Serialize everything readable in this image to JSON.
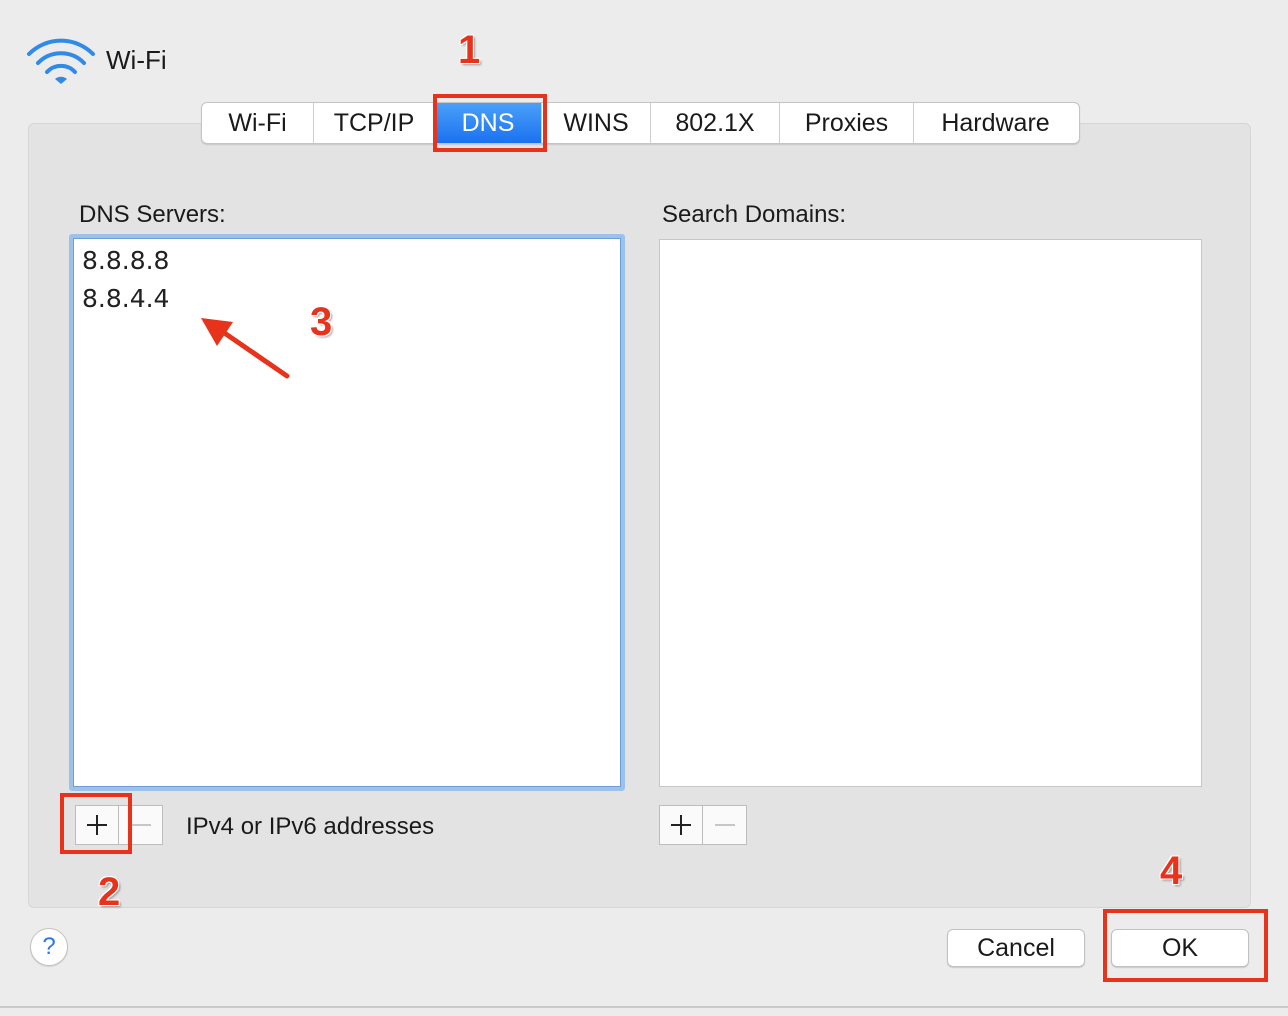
{
  "header": {
    "title": "Wi-Fi",
    "icon": "wifi-icon"
  },
  "tabs": [
    {
      "label": "Wi-Fi"
    },
    {
      "label": "TCP/IP"
    },
    {
      "label": "DNS",
      "selected": true
    },
    {
      "label": "WINS"
    },
    {
      "label": "802.1X"
    },
    {
      "label": "Proxies"
    },
    {
      "label": "Hardware"
    }
  ],
  "dns": {
    "label": "DNS Servers:",
    "servers": [
      "8.8.8.8",
      "8.8.4.4"
    ],
    "hint": "IPv4 or IPv6 addresses"
  },
  "search_domains": {
    "label": "Search Domains:",
    "items": []
  },
  "footer": {
    "help_label": "?",
    "cancel_label": "Cancel",
    "ok_label": "OK"
  },
  "annotations": {
    "step1": "1",
    "step2": "2",
    "step3": "3",
    "step4": "4",
    "color": "#e8331c"
  },
  "colors": {
    "accent": "#1a72f0",
    "focus_ring": "#9cc2ec",
    "panel": "#e3e3e3"
  }
}
